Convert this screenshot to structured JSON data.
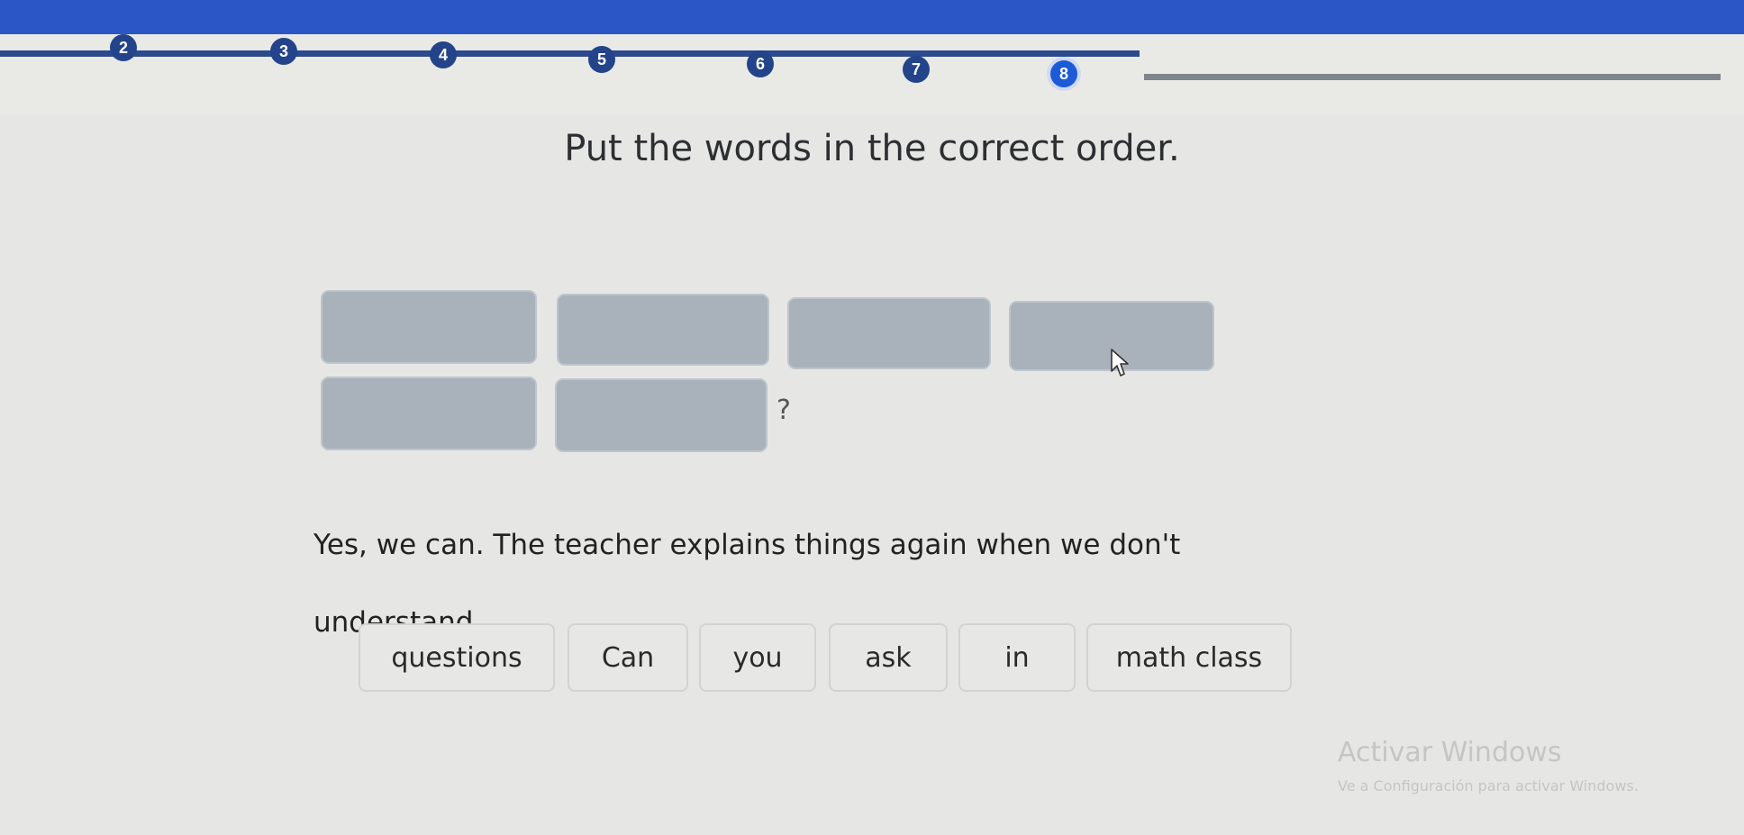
{
  "progress": {
    "steps": [
      "2",
      "3",
      "4",
      "5",
      "6",
      "7",
      "8"
    ],
    "current": "8"
  },
  "exercise": {
    "title": "Put the words in the correct order.",
    "question_mark": "?",
    "prompt_line1": "Yes, we can. The teacher explains things again when we don't",
    "prompt_line2": "understand.",
    "words": [
      "questions",
      "Can",
      "you",
      "ask",
      "in",
      "math class"
    ]
  },
  "watermark": {
    "title": "Activar Windows",
    "subtitle": "Ve a Configuración para activar Windows."
  },
  "colors": {
    "top_bar": "#2a56c6",
    "step_fill": "#23448a",
    "current_step": "#1d5ad6",
    "answer_slot": "#a9b1bb"
  },
  "icons": {
    "cursor": "mouse-pointer-icon"
  }
}
